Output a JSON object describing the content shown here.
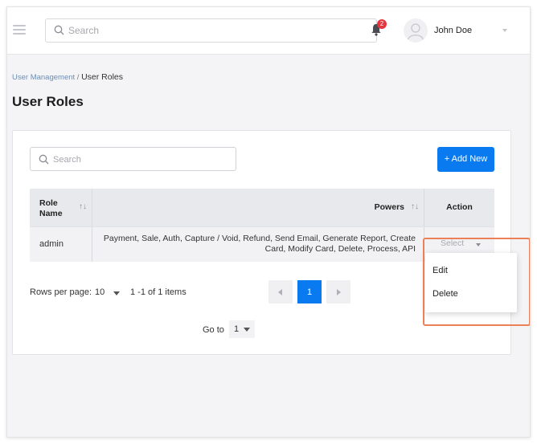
{
  "header": {
    "search_placeholder": "Search",
    "notification_count": "2",
    "user_name": "John Doe"
  },
  "breadcrumb": {
    "parent": "User Management",
    "separator": "/",
    "current": "User Roles"
  },
  "page": {
    "title": "User Roles"
  },
  "toolbar": {
    "search_placeholder": "Search",
    "add_button_label": "+ Add New"
  },
  "table": {
    "columns": {
      "role_name_line1": "Role",
      "role_name_line2": "Name",
      "powers": "Powers",
      "action": "Action"
    },
    "sort_glyph": "↑↓",
    "rows": [
      {
        "role": "admin",
        "powers_line1": "Payment, Sale, Auth, Capture / Void, Refund, Send Email, Generate Report, Create",
        "powers_line2": "Card, Modify Card, Delete, Process, API",
        "action_placeholder": "Select"
      }
    ]
  },
  "pagination": {
    "rows_per_page_label": "Rows per page:",
    "rows_per_page_value": "10",
    "range_text": "1 -1 of 1  items",
    "current_page": "1",
    "goto_label": "Go to",
    "goto_value": "1"
  },
  "action_menu": {
    "items": [
      "Edit",
      "Delete"
    ]
  },
  "colors": {
    "primary": "#0a7af0",
    "badge": "#e4373f",
    "highlight": "#ec8159"
  }
}
